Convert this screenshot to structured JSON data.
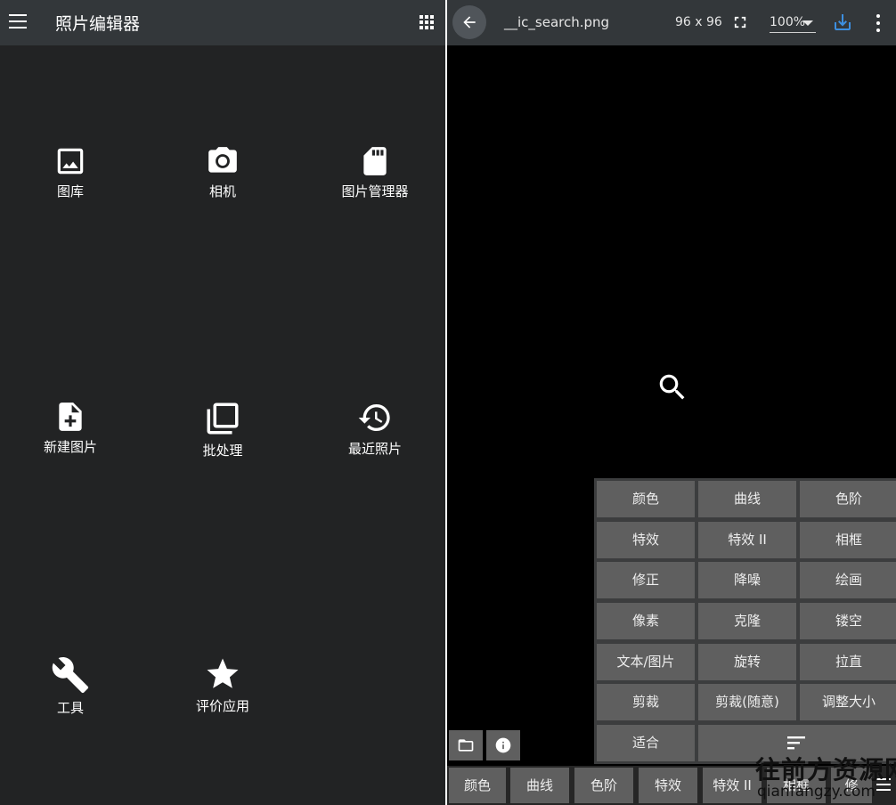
{
  "left_app": {
    "title": "照片编辑器",
    "menu_icon": "hamburger-menu-icon",
    "apps_icon": "grid-apps-icon",
    "tiles": [
      {
        "label": "图库",
        "icon": "image-icon"
      },
      {
        "label": "相机",
        "icon": "camera-icon"
      },
      {
        "label": "图片管理器",
        "icon": "sd-card-icon"
      },
      {
        "label": "新建图片",
        "icon": "new-file-icon"
      },
      {
        "label": "批处理",
        "icon": "batch-copy-icon"
      },
      {
        "label": "最近照片",
        "icon": "history-icon"
      },
      {
        "label": "工具",
        "icon": "wrench-icon"
      },
      {
        "label": "评价应用",
        "icon": "star-icon"
      }
    ]
  },
  "right_app": {
    "file_name": "__ic_search.png",
    "dimensions": "96 x 96",
    "zoom": "100%",
    "icons": {
      "back": "arrow-back-icon",
      "fullscreen": "fullscreen-icon",
      "download": "download-icon",
      "more": "more-vert-icon",
      "canvas": "search-icon"
    },
    "tools": [
      "颜色",
      "曲线",
      "色阶",
      "特效",
      "特效 II",
      "相框",
      "修正",
      "降噪",
      "绘画",
      "像素",
      "克隆",
      "镂空",
      "文本/图片",
      "旋转",
      "拉直",
      "剪裁",
      "剪裁(随意)",
      "调整大小",
      "适合"
    ],
    "bottom_bar": [
      "颜色",
      "曲线",
      "色阶",
      "特效",
      "特效 II",
      "相框",
      "修"
    ]
  },
  "watermark": {
    "title": "往前方资源网",
    "url": "qianfangzy.com"
  },
  "colors": {
    "background": "#222324",
    "appbar": "#33373a",
    "tool_button": "#5f5f5f",
    "accent_download": "#3d8fe0"
  }
}
